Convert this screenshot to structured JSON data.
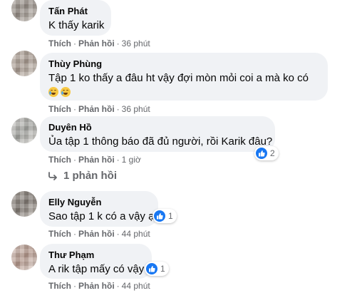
{
  "comments": [
    {
      "author": "Tấn Phát",
      "text": "K thấy karik",
      "like": "Thích",
      "reply": "Phản hồi",
      "time": "36 phút"
    },
    {
      "author": "Thùy Phùng",
      "text": "Tập 1 ko thấy a đâu ht vậy đợi mòn mỏi coi a mà ko có",
      "emoji": "crying-face",
      "like": "Thích",
      "reply": "Phản hồi",
      "time": "36 phút"
    },
    {
      "author": "Duyên Hồ",
      "text": "Ủa tập 1 thông báo đã đủ người, rồi Karik đâu?",
      "like": "Thích",
      "reply": "Phản hồi",
      "time": "1 giờ",
      "reactions": "2"
    },
    {
      "author": "Elly Nguyễn",
      "text": "Sao tập 1 k có a vậy ạ",
      "like": "Thích",
      "reply": "Phản hồi",
      "time": "44 phút",
      "reactions": "1"
    },
    {
      "author": "Thư Phạm",
      "text": "A rik tập mấy có vậy",
      "like": "Thích",
      "reply": "Phản hồi",
      "time": "44 phút",
      "reactions": "1"
    }
  ],
  "replies_link": "1 phản hồi",
  "colors": {
    "bubble": "#f0f2f5",
    "meta": "#65676b",
    "like": "#1877f2"
  }
}
